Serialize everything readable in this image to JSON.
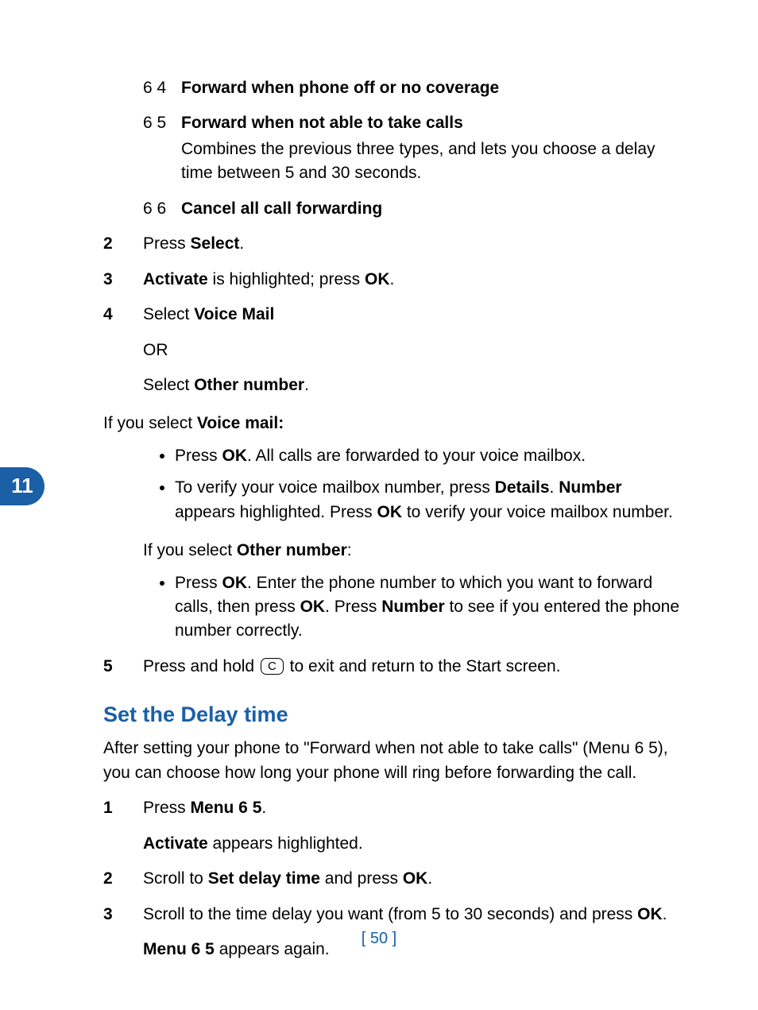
{
  "tab": "11",
  "sub_items": [
    {
      "num": "6 4",
      "title": "Forward when phone off or no coverage",
      "desc": ""
    },
    {
      "num": "6 5",
      "title": "Forward when not able to take calls",
      "desc": "Combines the previous three types, and lets you choose a delay time between 5 and 30 seconds."
    },
    {
      "num": "6 6",
      "title": "Cancel all call forwarding",
      "desc": ""
    }
  ],
  "steps_a": {
    "s2_num": "2",
    "s2_a": "Press ",
    "s2_b": "Select",
    "s2_c": ".",
    "s3_num": "3",
    "s3_a": "Activate",
    "s3_b": " is highlighted; press ",
    "s3_c": "OK",
    "s3_d": ".",
    "s4_num": "4",
    "s4_a": "Select ",
    "s4_b": "Voice Mail",
    "s4_or": "OR",
    "s4_c": "Select ",
    "s4_d": "Other number",
    "s4_e": "."
  },
  "voice_intro_a": "If you select ",
  "voice_intro_b": "Voice mail:",
  "voice_bullets": {
    "b1_a": "Press ",
    "b1_b": "OK",
    "b1_c": ". All calls are forwarded to your voice mailbox.",
    "b2_a": "To verify your voice mailbox number, press ",
    "b2_b": "Details",
    "b2_c": ". ",
    "b2_d": "Number",
    "b2_e": " appears highlighted. Press ",
    "b2_f": "OK",
    "b2_g": " to verify your voice mailbox number."
  },
  "other_intro_a": "If you select ",
  "other_intro_b": "Other number",
  "other_intro_c": ":",
  "other_bullets": {
    "b1_a": "Press ",
    "b1_b": "OK",
    "b1_c": ". Enter the phone number to which you want to forward calls, then press ",
    "b1_d": "OK",
    "b1_e": ". Press ",
    "b1_f": "Number",
    "b1_g": " to see if you entered the phone number correctly."
  },
  "step5_num": "5",
  "step5_a": "Press and hold ",
  "step5_key": "C",
  "step5_b": " to exit and return to the Start screen.",
  "heading": "Set the Delay time",
  "heading_para": "After setting your phone to \"Forward when not able to take calls\" (Menu 6 5), you can choose how long your phone will ring before forwarding the call.",
  "steps_b": {
    "s1_num": "1",
    "s1_a": "Press ",
    "s1_b": "Menu 6 5",
    "s1_c": ".",
    "s1_ex_a": "Activate",
    "s1_ex_b": " appears highlighted.",
    "s2_num": "2",
    "s2_a": "Scroll to ",
    "s2_b": "Set delay time",
    "s2_c": " and press ",
    "s2_d": "OK",
    "s2_e": ".",
    "s3_num": "3",
    "s3_a": "Scroll to the time delay you want (from 5 to 30 seconds) and press ",
    "s3_b": "OK",
    "s3_c": ".",
    "s3_ex_a": "Menu 6 5",
    "s3_ex_b": " appears again."
  },
  "page_number": "[ 50 ]"
}
